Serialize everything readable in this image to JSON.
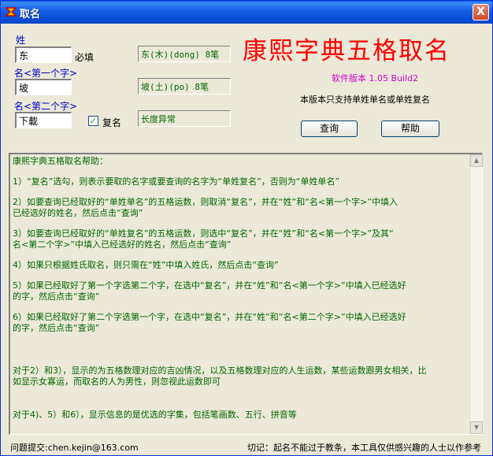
{
  "window": {
    "title": "取名",
    "close_label": "X"
  },
  "form": {
    "surname_label": "姓",
    "surname_value": "东",
    "required_label": "必填",
    "first_char_label": "名<第一个字>",
    "first_char_value": "坡",
    "second_char_label": "名<第二个字>",
    "second_char_value": "下載",
    "compound_checkbox_label": "复名",
    "compound_checked": true
  },
  "readouts": {
    "surname": "东(木)(dong) 8笔",
    "first_char": "坡(土)(po) 8笔",
    "second_char": "长度异常"
  },
  "header": {
    "app_title": "康熙字典五格取名",
    "version": "软件版本 1.05 Build2",
    "notice": "本版本只支持单姓单名或单姓复名"
  },
  "buttons": {
    "query": "查询",
    "help": "帮助"
  },
  "help": {
    "heading": "康熙字典五格取名帮助：",
    "p1": "1）“复名”选勾，则表示要取的名字或要查询的名字为“单姓复名”，否则为“单姓单名”",
    "p2": "2）如要查询已经取好的“单姓单名”的五格运数，则取消“复名”，并在“姓”和“名<第一个字>”中填入\n已经选好的姓名，然后点击“查询”",
    "p3": "3）如要查询已经取好的“单姓复名”的五格运数，则选中“复名”，并在“姓”和“名<第一个字>”及其“\n名<第二个字>”中填入已经选好的姓名，然后点击“查询”",
    "p4": "4）如果只根据姓氏取名，则只需在“姓”中填入姓氏，然后点击“查询”",
    "p5": "5）如果已经取好了第一个字选第二个字，在选中“复名”，并在“姓”和“名<第一个字>”中填入已经选好\n的字，然后点击“查询”",
    "p6": "6）如果已经取好了第二个字选第一个字，在选中“复名”，并在“姓”和“名<第二个字>”中填入已经选好\n的字，然后点击“查询”",
    "p7": "对于2）和3），显示的为五格数理对应的吉凶情况，以及五格数理对应的人生运数，某些运数跟男女相关，比\n如显示女寡运，而取名的人为男性，则忽视此运数即可",
    "p8": "对于4)、5）和6），显示信息的是优选的字集，包括笔画数、五行、拼音等"
  },
  "footer": {
    "contact": "问题提交:chen.kejin@163.com",
    "disclaimer": "切记：起名不能过于教条，本工具仅供感兴趣的人士以作参考"
  },
  "colors": {
    "titlebar": "#0a5ae8",
    "app_title": "#ff0000",
    "version": "#cc00cc",
    "help_text": "#006600",
    "label": "#0000cc"
  }
}
